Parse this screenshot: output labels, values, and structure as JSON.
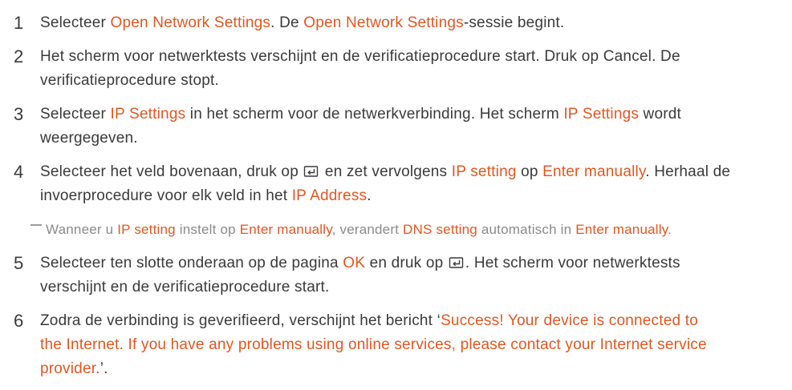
{
  "steps": [
    {
      "number": "1",
      "lines": [
        [
          "Selecteer ",
          "Open Network Settings",
          ". De ",
          "Open Network Settings",
          "-sessie begint."
        ]
      ]
    },
    {
      "number": "2",
      "lines": [
        [
          "Het scherm voor netwerktests verschijnt en de verificatieprocedure start. Druk op Cancel. De"
        ],
        [
          "verificatieprocedure stopt."
        ]
      ]
    },
    {
      "number": "3",
      "lines": [
        [
          "Selecteer ",
          "IP Settings",
          " in het scherm voor de netwerkverbinding. Het scherm ",
          "IP Settings",
          " wordt"
        ],
        [
          "weergegeven."
        ]
      ]
    },
    {
      "number": "4",
      "lines": [
        [
          "Selecteer het veld bovenaan, druk op ",
          " en zet vervolgens ",
          "IP setting",
          " op ",
          "Enter manually",
          ". Herhaal de"
        ],
        [
          "invoerprocedure voor elk veld in het ",
          "IP Address",
          "."
        ]
      ]
    },
    {
      "number": "5",
      "lines": [
        [
          "Selecteer ten slotte onderaan op de pagina ",
          "OK",
          " en druk op ",
          ". Het scherm voor netwerktests"
        ],
        [
          "verschijnt en de verificatieprocedure start."
        ]
      ]
    },
    {
      "number": "6",
      "lines": [
        [
          "Zodra de verbinding is geverifieerd, verschijnt het bericht ‘",
          "Success! Your device is connected to"
        ],
        [
          "the Internet. If you have any problems using online services, please contact your Internet service"
        ],
        [
          "provider.",
          "’."
        ]
      ]
    }
  ],
  "note": {
    "segments": [
      "Wanneer u ",
      "IP setting",
      " instelt op ",
      "Enter manually",
      ", verandert ",
      "DNS setting",
      " automatisch in ",
      "Enter manually",
      "."
    ]
  },
  "icons": {
    "enter_key": "enter-key-icon"
  },
  "colors": {
    "text": "#3a3a3a",
    "highlight": "#e4561f",
    "note_text": "#8a8a8a",
    "background": "#ffffff"
  }
}
